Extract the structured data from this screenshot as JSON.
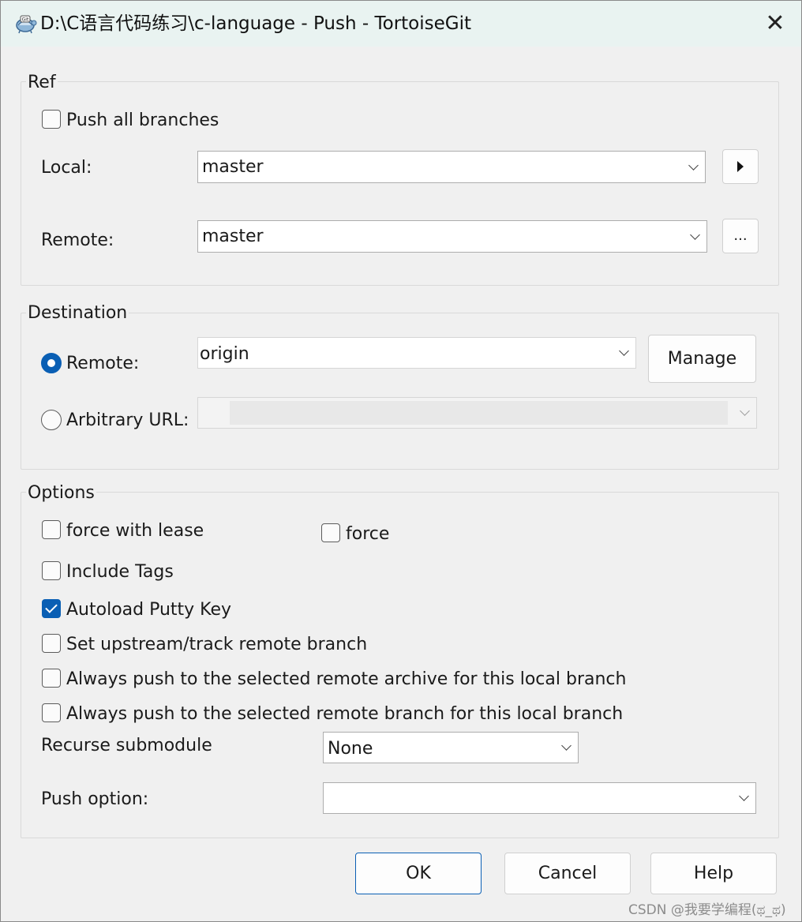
{
  "window": {
    "title": "D:\\C语言代码练习\\c-language - Push - TortoiseGit",
    "close_glyph": "✕",
    "app_icon": "tortoisegit-icon"
  },
  "ref": {
    "label": "Ref",
    "push_all_branches": {
      "label": "Push all branches",
      "checked": false
    },
    "local": {
      "label": "Local:",
      "value": "master"
    },
    "local_button": "right-triangle-icon",
    "remote": {
      "label": "Remote:",
      "value": "master"
    },
    "remote_button_label": "..."
  },
  "destination": {
    "label": "Destination",
    "remote_radio": {
      "label": "Remote:",
      "selected": true
    },
    "remote_value": "origin",
    "manage_label": "Manage",
    "arbitrary_radio": {
      "label": "Arbitrary URL:",
      "selected": false
    },
    "arbitrary_value": ""
  },
  "options": {
    "label": "Options",
    "force_with_lease": {
      "label": "force with lease",
      "checked": false
    },
    "force": {
      "label": "force",
      "checked": false
    },
    "include_tags": {
      "label": "Include Tags",
      "checked": false
    },
    "autoload_putty_key": {
      "label": "Autoload Putty Key",
      "checked": true
    },
    "set_upstream": {
      "label": "Set upstream/track remote branch",
      "checked": false
    },
    "always_push_archive": {
      "label": "Always push to the selected remote archive for this local branch",
      "checked": false
    },
    "always_push_branch": {
      "label": "Always push to the selected remote branch for this local branch",
      "checked": false
    },
    "recurse_submodule": {
      "label": "Recurse submodule",
      "value": "None"
    },
    "push_option": {
      "label": "Push option:",
      "value": ""
    }
  },
  "buttons": {
    "ok": "OK",
    "cancel": "Cancel",
    "help": "Help"
  },
  "watermark": "CSDN @我要学编程(ಥ_ಥ)",
  "colors": {
    "accent": "#0a5fb4",
    "title_bar": "#e9f3f1",
    "dialog_bg": "#f0f0f0"
  }
}
